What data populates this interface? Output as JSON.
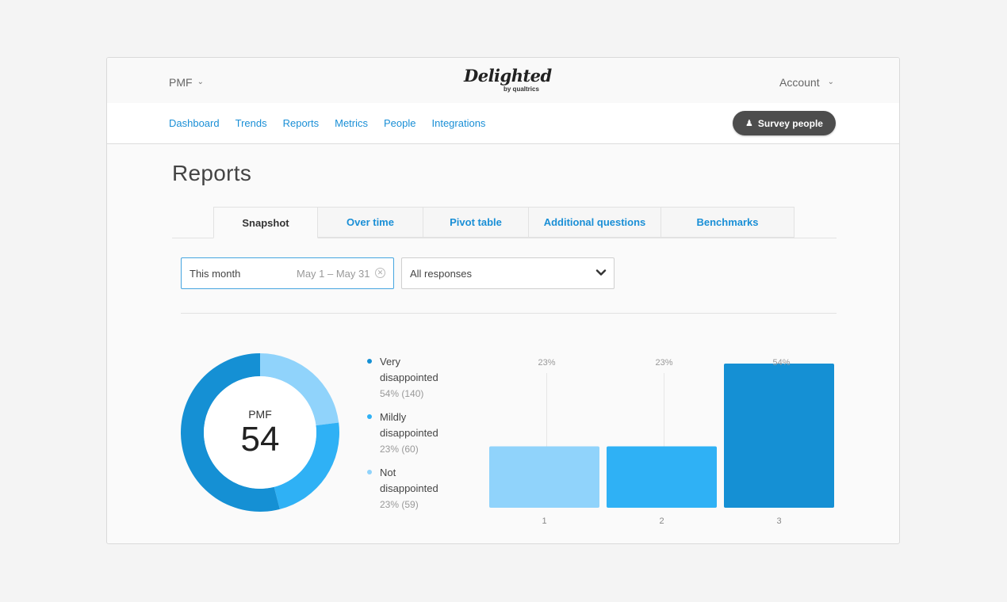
{
  "header": {
    "project_label": "PMF",
    "logo_text": "Delighted",
    "logo_sub": "by qualtrics",
    "account_label": "Account"
  },
  "nav": {
    "links": [
      "Dashboard",
      "Trends",
      "Reports",
      "Metrics",
      "People",
      "Integrations"
    ],
    "survey_button": "Survey people"
  },
  "page": {
    "title": "Reports",
    "tabs": [
      "Snapshot",
      "Over time",
      "Pivot table",
      "Additional questions",
      "Benchmarks"
    ],
    "active_tab": "Snapshot"
  },
  "filters": {
    "date_label": "This month",
    "date_range": "May 1 – May 31",
    "responses": "All responses"
  },
  "summary": {
    "label": "PMF",
    "value": "54"
  },
  "legend": [
    {
      "name": "Very disappointed",
      "stat": "54% (140)",
      "color": "#1590d4"
    },
    {
      "name": "Mildly disappointed",
      "stat": "23% (60)",
      "color": "#2fb1f5"
    },
    {
      "name": "Not disappointed",
      "stat": "23% (59)",
      "color": "#90d3fb"
    }
  ],
  "colors": {
    "accent": "#1a8fd6",
    "very": "#1590d4",
    "mildly": "#2fb1f5",
    "not": "#90d3fb"
  },
  "chart_data": [
    {
      "type": "pie",
      "labels": [
        "Very disappointed",
        "Mildly disappointed",
        "Not disappointed"
      ],
      "values": [
        54,
        23,
        23
      ],
      "colors": [
        "#1590d4",
        "#2fb1f5",
        "#90d3fb"
      ],
      "center_label": "PMF",
      "center_value": "54"
    },
    {
      "type": "bar",
      "categories": [
        "1",
        "2",
        "3"
      ],
      "values": [
        23,
        23,
        54
      ],
      "data_labels": [
        "23%",
        "23%",
        "54%"
      ],
      "colors": [
        "#90d3fb",
        "#2fb1f5",
        "#1590d4"
      ],
      "ylim": [
        0,
        54
      ]
    }
  ]
}
